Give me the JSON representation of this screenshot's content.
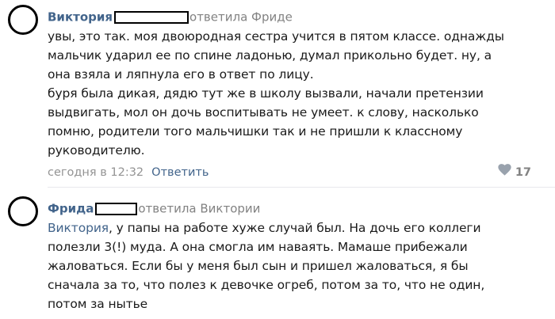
{
  "comments": [
    {
      "author": "Виктория",
      "replied_text": "ответила Фриде",
      "text_lines": [
        "увы, это так. моя двоюродная сестра учится в пятом классе. однажды",
        "мальчик ударил ее по спине ладонью, думал прикольно будет. ну, а",
        "она взяла и ляпнула его в ответ по лицу.",
        "буря была дикая, дядю тут же в школу вызвали, начали претензии",
        "выдвигать, мол он дочь воспитывать не умеет. к слову, насколько",
        "помню, родители того мальчишки так и не пришли к классному",
        "руководителю."
      ],
      "date": "сегодня в 12:32",
      "reply_label": "Ответить",
      "likes": "17",
      "like_icon": "heart-icon"
    },
    {
      "author": "Фрида",
      "replied_text": "ответила Виктории",
      "mention": "Виктория",
      "first_line_rest": ", у папы на работе хуже случай был. На дочь его коллеги",
      "text_lines": [
        "полезли 3(!) муда. А она смогла им наваять. Мамаше прибежали",
        "жаловаться. Если бы у меня был сын и пришел жаловаться, я бы",
        "сначала за то, что полез к девочке огреб, потом за то, что не один,",
        "потом за нытье"
      ]
    }
  ],
  "colors": {
    "author": "#42648b",
    "meta": "#828282",
    "text": "#1a1a1a"
  }
}
